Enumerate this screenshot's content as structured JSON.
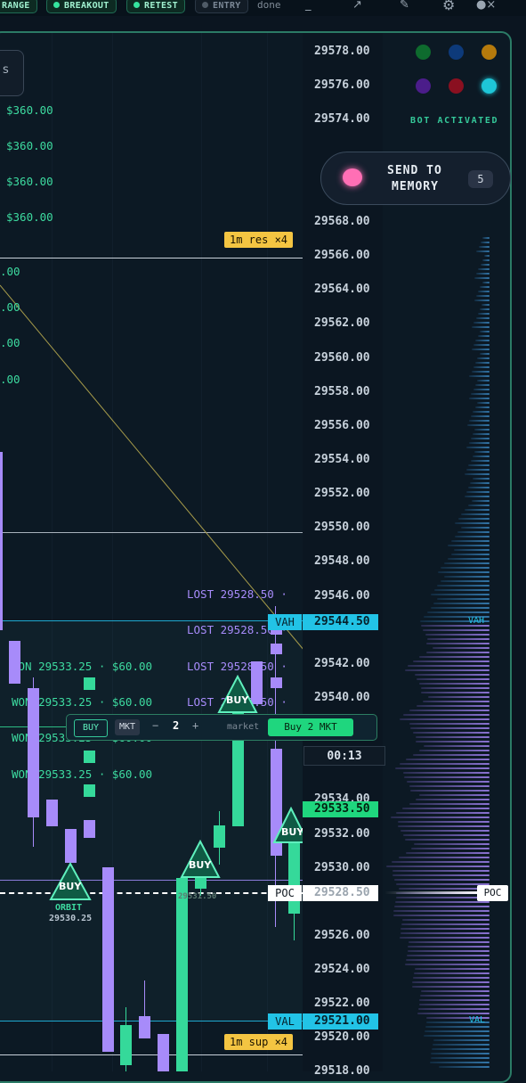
{
  "toolbar": {
    "buttons": [
      {
        "label": "RANGE",
        "active": true
      },
      {
        "label": "BREAKOUT",
        "active": true
      },
      {
        "label": "RETEST",
        "active": true
      },
      {
        "label": "ENTRY",
        "active": false
      }
    ],
    "status": "done",
    "icons": [
      "minimize-icon",
      "arrow-icon",
      "pencil-icon",
      "gear-icon",
      "close-icon"
    ]
  },
  "price_axis": {
    "ticks": [
      "29578.00",
      "29576.00",
      "29574.00",
      "29568.00",
      "29566.00",
      "29564.00",
      "29562.00",
      "29560.00",
      "29558.00",
      "29556.00",
      "29554.00",
      "29552.00",
      "29550.00",
      "29548.00",
      "29546.00",
      "29542.00",
      "29540.00",
      "29534.00",
      "29532.00",
      "29530.00",
      "29526.00",
      "29524.00",
      "29522.00",
      "29520.00",
      "29518.00"
    ],
    "vah": {
      "tag": "VAH",
      "price": "29544.50"
    },
    "val": {
      "tag": "VAL",
      "price": "29521.00"
    },
    "poc": {
      "tag": "POC",
      "price": "29528.50"
    },
    "last_price": "29533.50",
    "countdown": "00:13"
  },
  "levels": {
    "res": "1m res ×4",
    "sup": "1m sup ×4"
  },
  "pnl_labels": {
    "top": [
      "$360.00",
      "$360.00",
      "$360.00",
      "$360.00"
    ],
    "mid": [
      ".00",
      ".00",
      ".00",
      ".00"
    ],
    "won": [
      "WON 29533.25 · $60.00",
      "WON 29533.25 · $60.00",
      "WON 29533.25 · $60.00",
      "WON 29533.25 · $60.00"
    ],
    "lost": [
      "LOST 29528.50 ·",
      "LOST 29528.50 ·",
      "LOST 29528.50 ·",
      "LOST 29528.50 ·"
    ]
  },
  "markers": [
    {
      "label": "BUY",
      "sub": "ORBIT",
      "price": "29530.25"
    },
    {
      "label": "BUY",
      "sub": "",
      "price": "29531.50"
    },
    {
      "label": "BUY",
      "sub": "",
      "price": ""
    },
    {
      "label": "BUY",
      "sub": "",
      "price": ""
    }
  ],
  "order_bar": {
    "side": "BUY",
    "type": "MKT",
    "minus": "−",
    "qty": "2",
    "plus": "+",
    "mode": "market",
    "submit": "Buy 2 MKT"
  },
  "bot": {
    "status": "BOT ACTIVATED",
    "colors": [
      "#0e6b2e",
      "#0d3a7a",
      "#b57a0c",
      "#4b1d8a",
      "#8a1020",
      "#1ec6d8"
    ]
  },
  "memory": {
    "label_line1": "SEND TO",
    "label_line2": "MEMORY",
    "count": "5"
  },
  "side_label": "s",
  "profile": {
    "vah": "VAH",
    "val": "VAL",
    "poc": "POC"
  },
  "colors": {
    "accent_green": "#35e39e",
    "cyan": "#22c3e6",
    "purple": "#a78bfa",
    "yellow": "#f4c542"
  }
}
